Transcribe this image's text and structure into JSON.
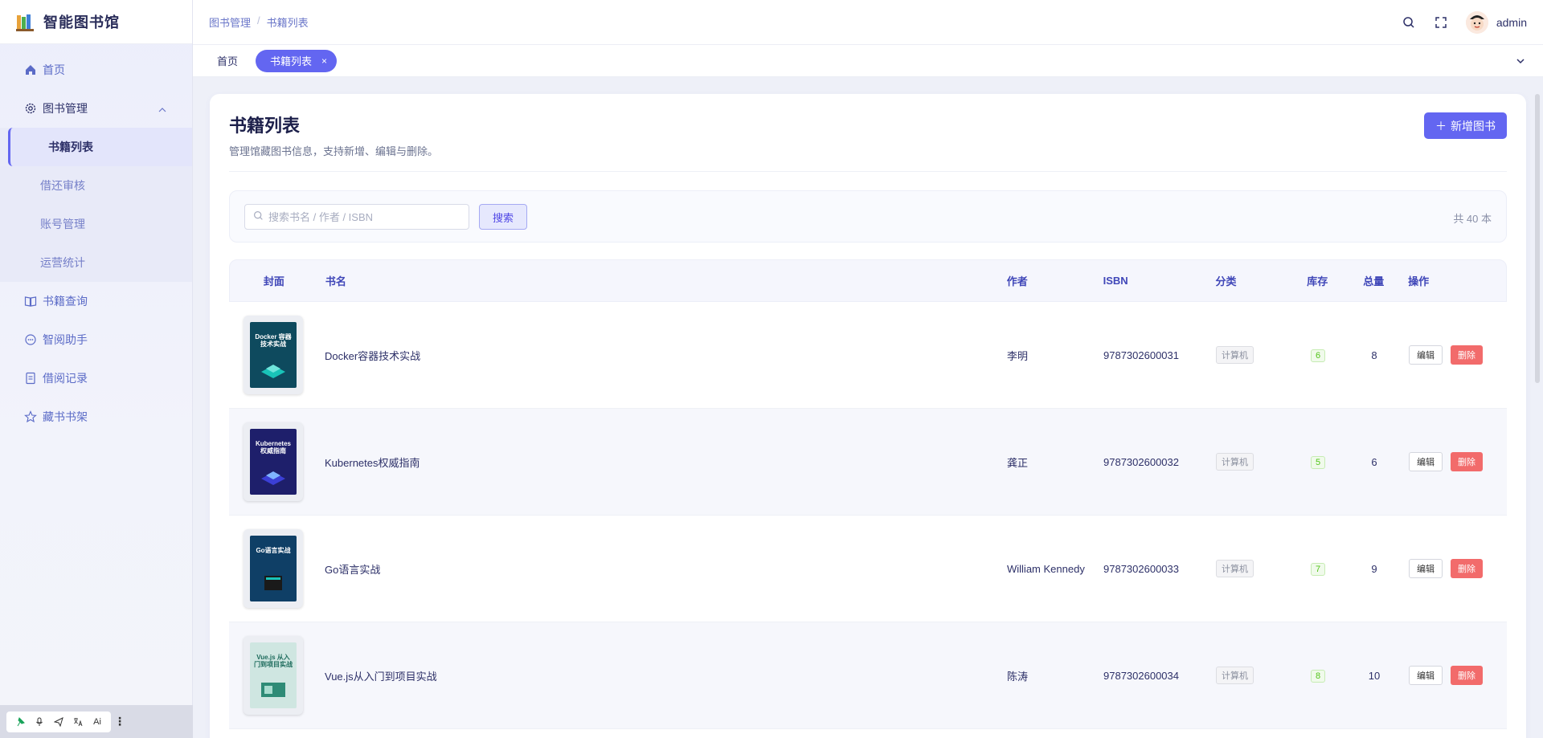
{
  "app": {
    "title": "智能图书馆"
  },
  "sidebar": {
    "items": [
      {
        "label": "首页"
      },
      {
        "label": "图书管理"
      },
      {
        "label": "书籍查询"
      },
      {
        "label": "智阅助手"
      },
      {
        "label": "借阅记录"
      },
      {
        "label": "藏书书架"
      }
    ],
    "sub_items": [
      {
        "label": "书籍列表"
      },
      {
        "label": "借还审核"
      },
      {
        "label": "账号管理"
      },
      {
        "label": "运营统计"
      }
    ]
  },
  "header": {
    "breadcrumb": [
      "图书管理",
      "书籍列表"
    ],
    "breadcrumb_sep": "/",
    "username": "admin"
  },
  "tabs": [
    {
      "label": "首页"
    },
    {
      "label": "书籍列表",
      "close": "×"
    }
  ],
  "page": {
    "title": "书籍列表",
    "description": "管理馆藏图书信息，支持新增、编辑与删除。",
    "add_button": "新增图书",
    "add_icon": "＋"
  },
  "search": {
    "placeholder": "搜索书名 / 作者 / ISBN",
    "value": "",
    "button": "搜索",
    "total": "共 40 本"
  },
  "table": {
    "headers": [
      "封面",
      "书名",
      "作者",
      "ISBN",
      "分类",
      "库存",
      "总量",
      "操作"
    ],
    "rows": [
      {
        "title": "Docker容器技术实战",
        "author": "李明",
        "isbn": "9787302600031",
        "category": "计算机",
        "stock": "6",
        "total": "8",
        "edit": "编辑",
        "delete": "删除",
        "cover_text": "Docker 容器技术实战",
        "cover_color": "#0e4a5e"
      },
      {
        "title": "Kubernetes权威指南",
        "author": "龚正",
        "isbn": "9787302600032",
        "category": "计算机",
        "stock": "5",
        "total": "6",
        "edit": "编辑",
        "delete": "删除",
        "cover_text": "Kubernetes 权威指南",
        "cover_color": "#1e1f6b"
      },
      {
        "title": "Go语言实战",
        "author": "William Kennedy",
        "isbn": "9787302600033",
        "category": "计算机",
        "stock": "7",
        "total": "9",
        "edit": "编辑",
        "delete": "删除",
        "cover_text": "Go语言实战",
        "cover_color": "#0f3f66"
      },
      {
        "title": "Vue.js从入门到项目实战",
        "author": "陈涛",
        "isbn": "9787302600034",
        "category": "计算机",
        "stock": "8",
        "total": "10",
        "edit": "编辑",
        "delete": "删除",
        "cover_text": "Vue.js 从入门到项目实战",
        "cover_color": "#cfe6e1"
      }
    ]
  },
  "toolbar": {
    "icons": [
      "pin-icon",
      "mic-icon",
      "send-icon",
      "translate-icon",
      "ai-icon"
    ],
    "ai_label": "Ai"
  },
  "colors": {
    "accent": "#6366f1",
    "danger": "#f26b6b",
    "success": "#52c41a"
  }
}
